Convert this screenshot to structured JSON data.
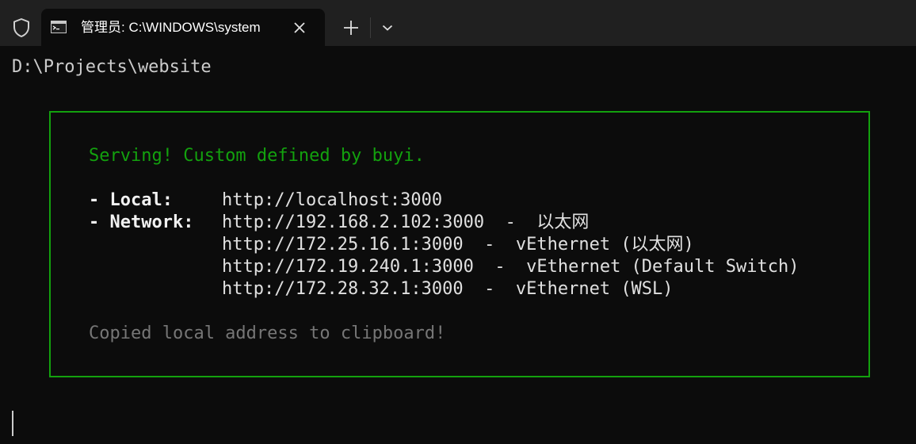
{
  "titlebar": {
    "tab_title": "管理员: C:\\WINDOWS\\system",
    "new_tab_icon": "plus-icon",
    "dropdown_icon": "chevron-down-icon",
    "close_icon": "close-icon",
    "shield_icon": "shield-icon"
  },
  "terminal": {
    "prompt": "D:\\Projects\\website",
    "serving": "Serving! Custom defined by buyi.",
    "local_label": "- Local:",
    "local_url": "http://localhost:3000",
    "network_label": "- Network:",
    "network": [
      "http://192.168.2.102:3000  -  以太网",
      "http://172.25.16.1:3000  -  vEthernet (以太网)",
      "http://172.19.240.1:3000  -  vEthernet (Default Switch)",
      "http://172.28.32.1:3000  -  vEthernet (WSL)"
    ],
    "copied": "Copied local address to clipboard!"
  },
  "colors": {
    "background": "#0c0c0c",
    "titlebar": "#202020",
    "green": "#13a10e",
    "text": "#cccccc",
    "dim": "#767676"
  }
}
